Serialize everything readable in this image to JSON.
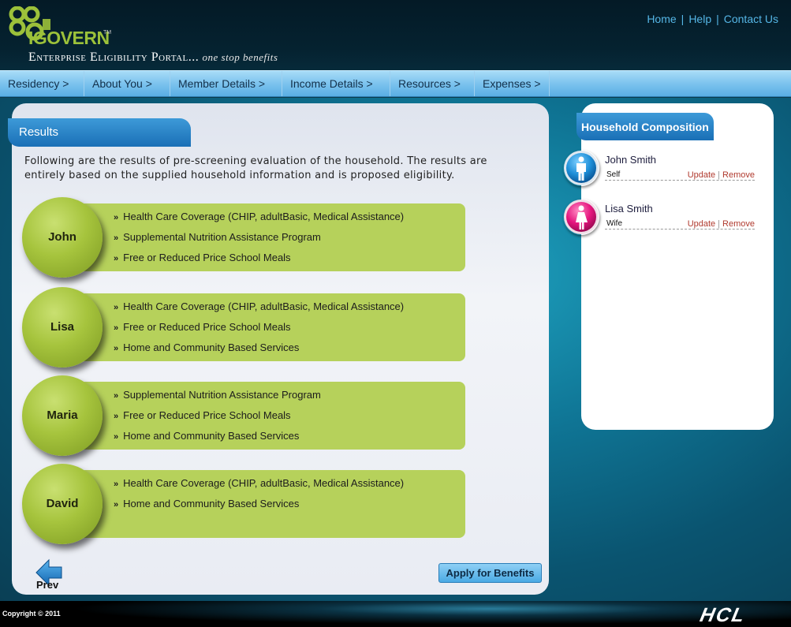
{
  "header": {
    "brand": "IGOVERN",
    "trademark": "TM",
    "tagline_main": "Enterprise Eligibility Portal...",
    "tagline_sub": "one stop benefits",
    "links": [
      "Home",
      "Help",
      "Contact Us"
    ],
    "link_separator": "|"
  },
  "nav": {
    "items": [
      "Residency >",
      "About You >",
      "Member Details >",
      "Income Details >",
      "Resources >",
      "Expenses >"
    ]
  },
  "results": {
    "tab_label": "Results",
    "intro": "Following are the results of pre-screening evaluation of the household. The results are entirely based on the supplied household information and is proposed eligibility.",
    "bullet": "»",
    "people": [
      {
        "name": "John",
        "benefits": [
          "Health Care Coverage (CHIP, adultBasic, Medical Assistance)",
          "Supplemental Nutrition Assistance Program",
          "Free or Reduced Price School Meals"
        ]
      },
      {
        "name": "Lisa",
        "benefits": [
          "Health Care Coverage (CHIP, adultBasic, Medical Assistance)",
          "Free or Reduced Price School Meals",
          "Home and Community Based Services"
        ]
      },
      {
        "name": "Maria",
        "benefits": [
          "Supplemental Nutrition Assistance Program",
          "Free or Reduced Price School Meals",
          "Home and Community Based Services"
        ]
      },
      {
        "name": "David",
        "benefits": [
          "Health Care Coverage (CHIP, adultBasic, Medical Assistance)",
          "Home and Community Based Services"
        ]
      }
    ],
    "prev_label": "Prev",
    "apply_label": "Apply for Benefits"
  },
  "household": {
    "title": "Household Composition",
    "members": [
      {
        "name": "John Smith",
        "relation": "Self",
        "update": "Update",
        "remove": "Remove",
        "icon": "male-user-icon",
        "color": "#1e8fd8"
      },
      {
        "name": "Lisa Smith",
        "relation": "Wife",
        "update": "Update",
        "remove": "Remove",
        "icon": "female-user-icon",
        "color": "#e5157e"
      }
    ],
    "action_separator": "|"
  },
  "footer": {
    "copyright": "Copyright © 2011",
    "company": "HCL"
  },
  "colors": {
    "accent_blue": "#1a6fb6",
    "card_green": "#b6d15b",
    "brand_green": "#9cc13a",
    "link_blue": "#55b6e6",
    "action_red": "#b03a2e"
  }
}
